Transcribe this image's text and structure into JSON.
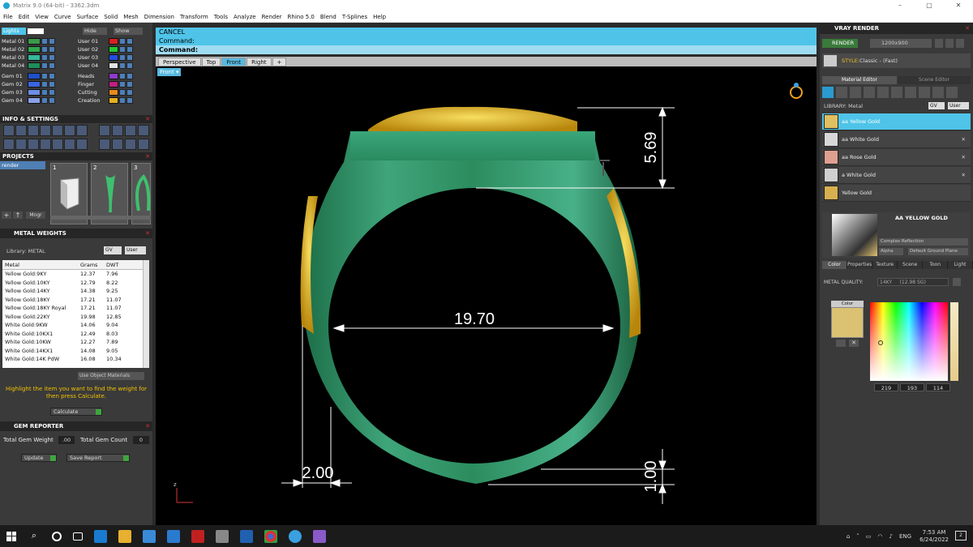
{
  "window": {
    "title": "Matrix 9.0 (64-bit) - 3362.3dm"
  },
  "menu": [
    "File",
    "Edit",
    "View",
    "Curve",
    "Surface",
    "Solid",
    "Mesh",
    "Dimension",
    "Transform",
    "Tools",
    "Analyze",
    "Render",
    "Rhino 5.0",
    "Blend",
    "T-Splines",
    "Help"
  ],
  "layers": {
    "lights_label": "Lights",
    "hide_label": "Hide",
    "show_label": "Show",
    "left": [
      {
        "name": "Metal 01",
        "color": "#3a9a4a"
      },
      {
        "name": "Metal 02",
        "color": "#2fa84f"
      },
      {
        "name": "Metal 03",
        "color": "#35b89a"
      },
      {
        "name": "Metal 04",
        "color": "#1f8c5c"
      },
      {
        "name": "Gem 01",
        "color": "#2050c8"
      },
      {
        "name": "Gem 02",
        "color": "#3a66e0"
      },
      {
        "name": "Gem 03",
        "color": "#6d8de8"
      },
      {
        "name": "Gem 04",
        "color": "#8aa0ea"
      }
    ],
    "right": [
      {
        "name": "User 01",
        "color": "#d82020"
      },
      {
        "name": "User 02",
        "color": "#23c830"
      },
      {
        "name": "User 03",
        "color": "#2050e0"
      },
      {
        "name": "User 04",
        "color": "#e2e2e2"
      },
      {
        "name": "Heads",
        "color": "#8e3ac8"
      },
      {
        "name": "Finger",
        "color": "#c02080"
      },
      {
        "name": "Cutting",
        "color": "#e88a1e"
      },
      {
        "name": "Creation",
        "color": "#e8b020"
      }
    ]
  },
  "info_settings": {
    "title": "INFO & SETTINGS"
  },
  "projects": {
    "title": "PROJECTS",
    "item": "render",
    "thumbs": [
      "1",
      "2",
      "3"
    ],
    "manager_label": "Mngr"
  },
  "metal_weights": {
    "title": "METAL WEIGHTS",
    "library_label": "Library:",
    "library_value": "METAL",
    "gv": "GV",
    "user": "User",
    "headers": [
      "Metal",
      "Grams",
      "DWT"
    ],
    "rows": [
      [
        "Yellow Gold:9KY",
        "12.37",
        "7.96"
      ],
      [
        "Yellow Gold:10KY",
        "12.79",
        "8.22"
      ],
      [
        "Yellow Gold:14KY",
        "14.38",
        "9.25"
      ],
      [
        "Yellow Gold:18KY",
        "17.21",
        "11.07"
      ],
      [
        "Yellow Gold:18KY Royal",
        "17.21",
        "11.07"
      ],
      [
        "Yellow Gold:22KY",
        "19.98",
        "12.85"
      ],
      [
        "White Gold:9KW",
        "14.06",
        "9.04"
      ],
      [
        "White Gold:10KX1",
        "12.49",
        "8.03"
      ],
      [
        "White Gold:10KW",
        "12.27",
        "7.89"
      ],
      [
        "White Gold:14KX1",
        "14.08",
        "9.05"
      ],
      [
        "White Gold:14K PdW",
        "16.08",
        "10.34"
      ]
    ],
    "use_object_materials": "Use Object Materials",
    "instruction": "Highlight the item you want to find the weight for then press Calculate.",
    "calculate": "Calculate"
  },
  "gem_reporter": {
    "title": "GEM REPORTER",
    "total_weight_label": "Total Gem Weight",
    "total_weight_value": ".00",
    "total_count_label": "Total Gem Count",
    "total_count_value": "0",
    "update": "Update",
    "save_report": "Save Report"
  },
  "command": {
    "line1": "CANCEL",
    "line2": "Command:",
    "line3": "Command:"
  },
  "viewtabs": [
    "Perspective",
    "Top",
    "Front",
    "Right"
  ],
  "viewport": {
    "label": "Front",
    "dims": {
      "top": "5.69",
      "width": "19.70",
      "thickness": "2.00",
      "bottom": "1.00"
    },
    "axis_label": "z"
  },
  "vray": {
    "title": "VRAY RENDER",
    "render_label": "RENDER",
    "resolution": "1200x900",
    "style_label": "STYLE:",
    "style_value": "Classic - (Fast)"
  },
  "editor": {
    "tab_material": "Material Editor",
    "tab_scene": "Scene Editor",
    "library_label": "LIBRARY: Metal",
    "gv": "GV",
    "user": "User",
    "materials": [
      {
        "name": "aa Yellow Gold",
        "thumb": "#e0c060"
      },
      {
        "name": "aa White Gold",
        "thumb": "#d8d8d8"
      },
      {
        "name": "aa Rose Gold",
        "thumb": "#e0a090"
      },
      {
        "name": "a White Gold",
        "thumb": "#cfcfcf"
      },
      {
        "name": "Yellow Gold",
        "thumb": "#d8b050"
      }
    ],
    "preview_name": "AA YELLOW GOLD",
    "reflection": "Complex Reflection",
    "alpha_label": "Alpha",
    "ground": "Default Ground Plane",
    "tabs": [
      "Color",
      "Properties",
      "Texture",
      "Scene",
      "Toon",
      "Light"
    ],
    "metal_quality_label": "METAL QUALITY:",
    "metal_quality_value": "14KY",
    "metal_quality_extra": "(12.98 SG)",
    "color_label": "Color",
    "rgb": [
      "219",
      "193",
      "114"
    ],
    "swatch": "#dbc172"
  },
  "taskbar": {
    "lang": "ENG",
    "time": "7:53 AM",
    "date": "6/24/2022",
    "notif": "2"
  }
}
